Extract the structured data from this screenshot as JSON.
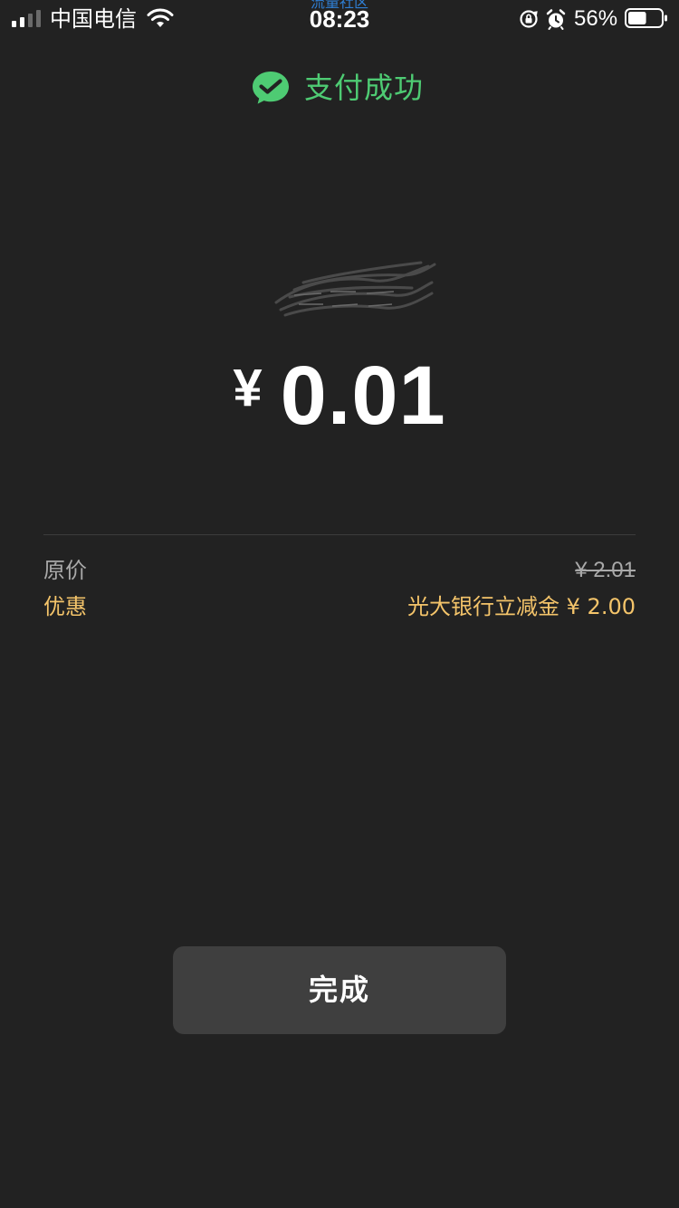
{
  "status_bar": {
    "carrier": "中国电信",
    "watermark": "流量社区",
    "time": "08:23",
    "battery_percent": "56%",
    "battery_level": 0.56,
    "signal_bars_filled": 2,
    "signal_bars_total": 4,
    "icons": [
      "signal-icon",
      "wifi-icon",
      "orientation-lock-icon",
      "alarm-icon",
      "battery-icon"
    ]
  },
  "header": {
    "title": "支付成功",
    "icon": "wechat-pay-icon",
    "accent_color": "#4ecb73"
  },
  "payment": {
    "currency_symbol": "¥",
    "amount": "0.01"
  },
  "details": {
    "original_price_label": "原价",
    "original_price_value": "¥ 2.01",
    "discount_label": "优惠",
    "discount_value": "光大银行立减金 ¥ 2.00",
    "discount_color": "#f4c46a"
  },
  "actions": {
    "done_label": "完成"
  }
}
